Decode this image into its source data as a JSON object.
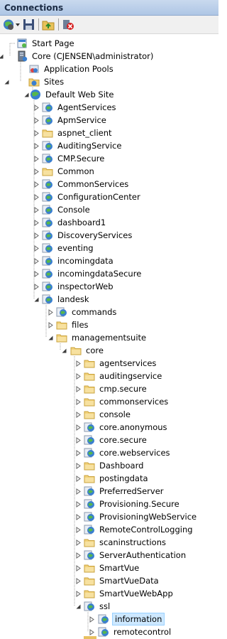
{
  "window": {
    "title": "Connections"
  },
  "toolbar": {
    "icons": [
      "connect-icon",
      "save-icon",
      "up-folder-icon",
      "disconnect-icon"
    ]
  },
  "tree": [
    {
      "label": "Start Page",
      "level": 0,
      "icon": "startpage",
      "exp": "none"
    },
    {
      "label": "Core (CJENSEN\\administrator)",
      "level": 0,
      "icon": "server",
      "exp": "open"
    },
    {
      "label": "Application Pools",
      "level": 1,
      "icon": "apppool",
      "exp": "none"
    },
    {
      "label": "Sites",
      "level": 1,
      "icon": "sites",
      "exp": "open"
    },
    {
      "label": "Default Web Site",
      "level": 2,
      "icon": "globe",
      "exp": "open"
    },
    {
      "label": "AgentServices",
      "level": 3,
      "icon": "app",
      "exp": "closed"
    },
    {
      "label": "ApmService",
      "level": 3,
      "icon": "app",
      "exp": "closed"
    },
    {
      "label": "aspnet_client",
      "level": 3,
      "icon": "folder",
      "exp": "closed"
    },
    {
      "label": "AuditingService",
      "level": 3,
      "icon": "app",
      "exp": "closed"
    },
    {
      "label": "CMP.Secure",
      "level": 3,
      "icon": "app",
      "exp": "closed"
    },
    {
      "label": "Common",
      "level": 3,
      "icon": "folder",
      "exp": "closed"
    },
    {
      "label": "CommonServices",
      "level": 3,
      "icon": "app",
      "exp": "closed"
    },
    {
      "label": "ConfigurationCenter",
      "level": 3,
      "icon": "app",
      "exp": "closed"
    },
    {
      "label": "Console",
      "level": 3,
      "icon": "app",
      "exp": "closed"
    },
    {
      "label": "dashboard1",
      "level": 3,
      "icon": "app",
      "exp": "closed"
    },
    {
      "label": "DiscoveryServices",
      "level": 3,
      "icon": "app",
      "exp": "closed"
    },
    {
      "label": "eventing",
      "level": 3,
      "icon": "app",
      "exp": "closed"
    },
    {
      "label": "incomingdata",
      "level": 3,
      "icon": "app",
      "exp": "closed"
    },
    {
      "label": "incomingdataSecure",
      "level": 3,
      "icon": "app",
      "exp": "closed"
    },
    {
      "label": "inspectorWeb",
      "level": 3,
      "icon": "app",
      "exp": "closed"
    },
    {
      "label": "landesk",
      "level": 3,
      "icon": "app",
      "exp": "open"
    },
    {
      "label": "commands",
      "level": 4,
      "icon": "app",
      "exp": "closed"
    },
    {
      "label": "files",
      "level": 4,
      "icon": "folder",
      "exp": "closed"
    },
    {
      "label": "managementsuite",
      "level": 4,
      "icon": "folder",
      "exp": "open"
    },
    {
      "label": "core",
      "level": 5,
      "icon": "folder",
      "exp": "open"
    },
    {
      "label": "agentservices",
      "level": 6,
      "icon": "folder",
      "exp": "closed"
    },
    {
      "label": "auditingservice",
      "level": 6,
      "icon": "folder",
      "exp": "closed"
    },
    {
      "label": "cmp.secure",
      "level": 6,
      "icon": "folder",
      "exp": "closed"
    },
    {
      "label": "commonservices",
      "level": 6,
      "icon": "folder",
      "exp": "closed"
    },
    {
      "label": "console",
      "level": 6,
      "icon": "folder",
      "exp": "closed"
    },
    {
      "label": "core.anonymous",
      "level": 6,
      "icon": "app",
      "exp": "closed"
    },
    {
      "label": "core.secure",
      "level": 6,
      "icon": "app",
      "exp": "closed"
    },
    {
      "label": "core.webservices",
      "level": 6,
      "icon": "app",
      "exp": "closed"
    },
    {
      "label": "Dashboard",
      "level": 6,
      "icon": "folder",
      "exp": "closed"
    },
    {
      "label": "postingdata",
      "level": 6,
      "icon": "folder",
      "exp": "closed"
    },
    {
      "label": "PreferredServer",
      "level": 6,
      "icon": "app",
      "exp": "closed"
    },
    {
      "label": "Provisioning.Secure",
      "level": 6,
      "icon": "app",
      "exp": "closed"
    },
    {
      "label": "ProvisioningWebService",
      "level": 6,
      "icon": "app",
      "exp": "closed"
    },
    {
      "label": "RemoteControlLogging",
      "level": 6,
      "icon": "app",
      "exp": "closed"
    },
    {
      "label": "scaninstructions",
      "level": 6,
      "icon": "folder",
      "exp": "closed"
    },
    {
      "label": "ServerAuthentication",
      "level": 6,
      "icon": "app",
      "exp": "closed"
    },
    {
      "label": "SmartVue",
      "level": 6,
      "icon": "folder",
      "exp": "closed"
    },
    {
      "label": "SmartVueData",
      "level": 6,
      "icon": "folder",
      "exp": "closed"
    },
    {
      "label": "SmartVueWebApp",
      "level": 6,
      "icon": "folder",
      "exp": "closed"
    },
    {
      "label": "ssl",
      "level": 6,
      "icon": "app",
      "exp": "open"
    },
    {
      "label": "information",
      "level": 7,
      "icon": "app",
      "exp": "closed",
      "selected": true
    },
    {
      "label": "remotecontrol",
      "level": 7,
      "icon": "app",
      "exp": "closed"
    }
  ]
}
